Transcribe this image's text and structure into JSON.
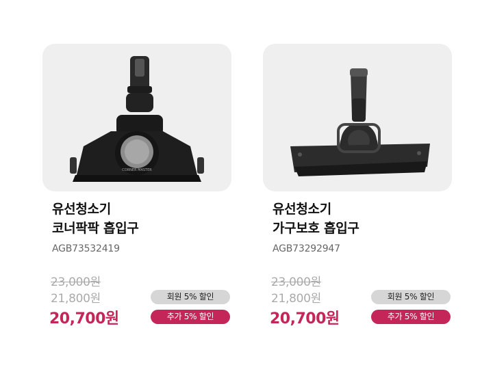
{
  "products": [
    {
      "image_alt": "유선청소기 코너팍팍 흡입구 product image",
      "title_line1": "유선청소기",
      "title_line2": "코너팍팍 흡입구",
      "model": "AGB73532419",
      "original_price": "23,000원",
      "member_price": "21,800원",
      "final_price": "20,700원",
      "badge_member": "회원 5% 할인",
      "badge_extra": "추가 5% 할인",
      "head_text": "CORNER MASTER"
    },
    {
      "image_alt": "유선청소기 가구보호 흡입구 product image",
      "title_line1": "유선청소기",
      "title_line2": "가구보호 흡입구",
      "model": "AGB73292947",
      "original_price": "23,000원",
      "member_price": "21,800원",
      "final_price": "20,700원",
      "badge_member": "회원 5% 할인",
      "badge_extra": "추가 5% 할인"
    }
  ],
  "colors": {
    "accent": "#c42659",
    "badge_gray": "#d6d6d6",
    "thumb_bg": "#efefef"
  }
}
